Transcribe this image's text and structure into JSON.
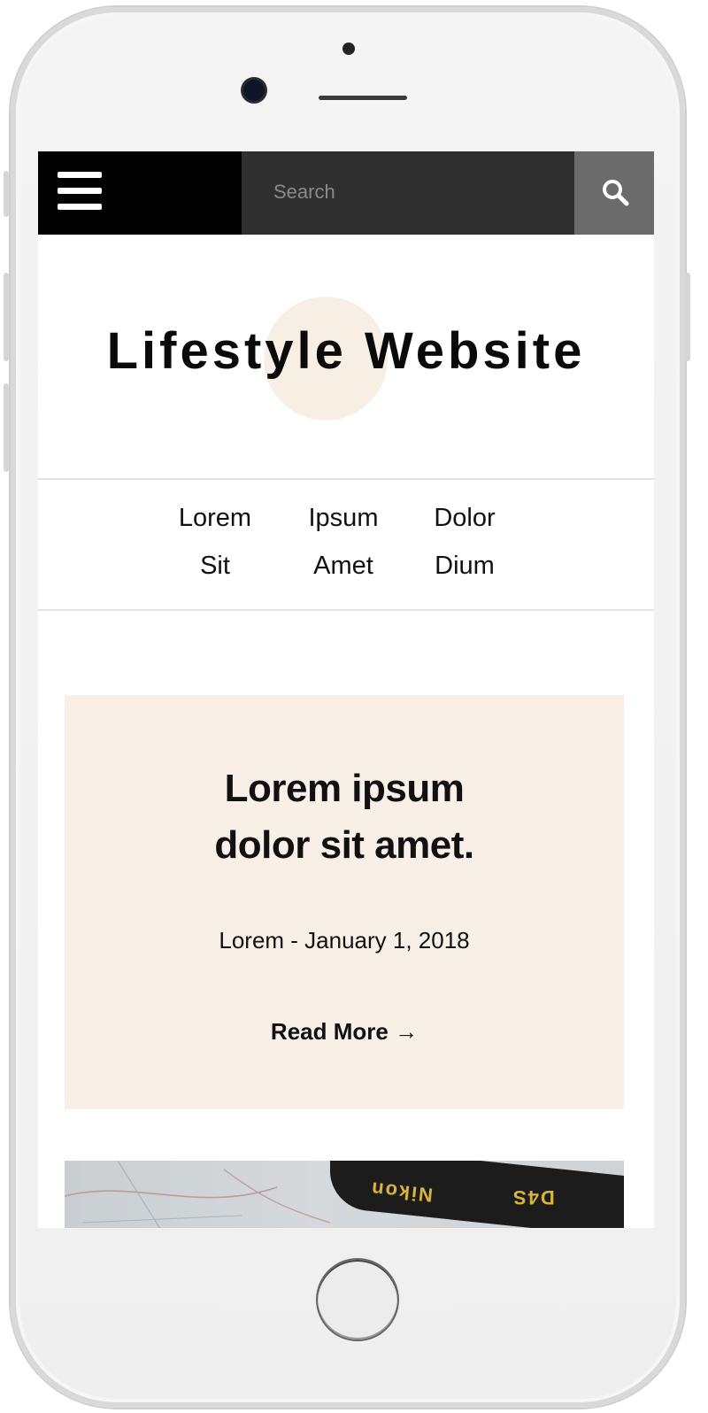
{
  "header": {
    "search_placeholder": "Search"
  },
  "site": {
    "title": "Lifestyle Website"
  },
  "nav": {
    "items": [
      "Lorem",
      "Ipsum",
      "Dolor",
      "Sit",
      "Amet",
      "Dium"
    ]
  },
  "post": {
    "title_line1": "Lorem ipsum",
    "title_line2": "dolor sit amet.",
    "meta": "Lorem - January 1, 2018",
    "read_more": "Read More →"
  },
  "photo": {
    "strap_left": "Nikon",
    "strap_right": "D4S"
  },
  "colors": {
    "accent_cream": "#f8f0e6",
    "header_black": "#000000",
    "search_bg": "#303030",
    "search_button": "#6b6b6b"
  },
  "icons": [
    "menu-icon",
    "search-icon",
    "arrow-right-icon"
  ]
}
